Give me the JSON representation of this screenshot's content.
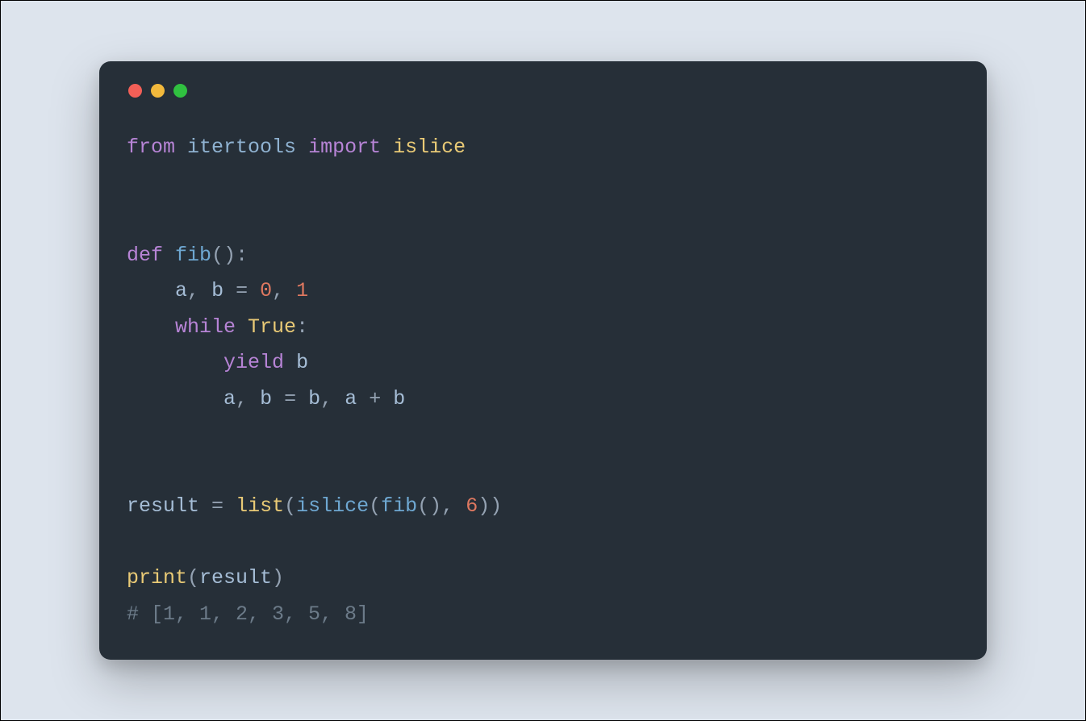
{
  "window": {
    "traffic": {
      "red": "#f25f57",
      "yellow": "#f2b93c",
      "green": "#30c140"
    }
  },
  "code": {
    "tokens": [
      [
        [
          "keyword",
          "from"
        ],
        [
          "default",
          " "
        ],
        [
          "module",
          "itertools"
        ],
        [
          "default",
          " "
        ],
        [
          "keyword",
          "import"
        ],
        [
          "default",
          " "
        ],
        [
          "clsname",
          "islice"
        ]
      ],
      [],
      [],
      [
        [
          "keyword",
          "def"
        ],
        [
          "default",
          " "
        ],
        [
          "funcname",
          "fib"
        ],
        [
          "punct",
          "("
        ],
        [
          "punct",
          ")"
        ],
        [
          "punct",
          ":"
        ]
      ],
      [
        [
          "default",
          "    "
        ],
        [
          "var",
          "a"
        ],
        [
          "punct",
          ","
        ],
        [
          "default",
          " "
        ],
        [
          "var",
          "b"
        ],
        [
          "default",
          " "
        ],
        [
          "op",
          "="
        ],
        [
          "default",
          " "
        ],
        [
          "num",
          "0"
        ],
        [
          "punct",
          ","
        ],
        [
          "default",
          " "
        ],
        [
          "num",
          "1"
        ]
      ],
      [
        [
          "default",
          "    "
        ],
        [
          "keyword",
          "while"
        ],
        [
          "default",
          " "
        ],
        [
          "clsname",
          "True"
        ],
        [
          "punct",
          ":"
        ]
      ],
      [
        [
          "default",
          "        "
        ],
        [
          "keyword",
          "yield"
        ],
        [
          "default",
          " "
        ],
        [
          "var",
          "b"
        ]
      ],
      [
        [
          "default",
          "        "
        ],
        [
          "var",
          "a"
        ],
        [
          "punct",
          ","
        ],
        [
          "default",
          " "
        ],
        [
          "var",
          "b"
        ],
        [
          "default",
          " "
        ],
        [
          "op",
          "="
        ],
        [
          "default",
          " "
        ],
        [
          "var",
          "b"
        ],
        [
          "punct",
          ","
        ],
        [
          "default",
          " "
        ],
        [
          "var",
          "a"
        ],
        [
          "default",
          " "
        ],
        [
          "op",
          "+"
        ],
        [
          "default",
          " "
        ],
        [
          "var",
          "b"
        ]
      ],
      [],
      [],
      [
        [
          "var",
          "result"
        ],
        [
          "default",
          " "
        ],
        [
          "op",
          "="
        ],
        [
          "default",
          " "
        ],
        [
          "builtin",
          "list"
        ],
        [
          "punct",
          "("
        ],
        [
          "funcname",
          "islice"
        ],
        [
          "punct",
          "("
        ],
        [
          "funcname",
          "fib"
        ],
        [
          "punct",
          "("
        ],
        [
          "punct",
          ")"
        ],
        [
          "punct",
          ","
        ],
        [
          "default",
          " "
        ],
        [
          "num",
          "6"
        ],
        [
          "punct",
          ")"
        ],
        [
          "punct",
          ")"
        ]
      ],
      [],
      [
        [
          "builtin",
          "print"
        ],
        [
          "punct",
          "("
        ],
        [
          "var",
          "result"
        ],
        [
          "punct",
          ")"
        ]
      ],
      [
        [
          "comment",
          "# [1, 1, 2, 3, 5, 8]"
        ]
      ]
    ]
  }
}
